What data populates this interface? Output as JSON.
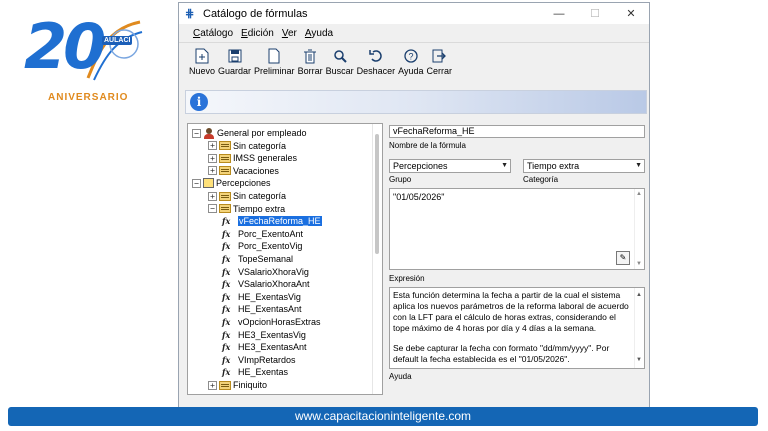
{
  "logo": {
    "number": "20",
    "badge": "AULACI",
    "anniversary": "ANIVERSARIO"
  },
  "window": {
    "title": "Catálogo de fórmulas",
    "controls": {
      "minimize": "—",
      "maximize": "☐",
      "close": "✕"
    }
  },
  "menu": [
    "Catálogo",
    "Edición",
    "Ver",
    "Ayuda"
  ],
  "toolbar": [
    {
      "label": "Nuevo",
      "icon": "new-doc-icon"
    },
    {
      "label": "Guardar",
      "icon": "save-icon"
    },
    {
      "label": "Preliminar",
      "icon": "preview-doc-icon"
    },
    {
      "label": "Borrar",
      "icon": "trash-icon"
    },
    {
      "label": "Buscar",
      "icon": "search-icon"
    },
    {
      "label": "Deshacer",
      "icon": "undo-icon"
    },
    {
      "label": "Ayuda",
      "icon": "help-icon"
    },
    {
      "label": "Cerrar",
      "icon": "exit-icon"
    }
  ],
  "info_icon": "i",
  "tree": {
    "nodes": [
      {
        "label": "General por empleado",
        "level": 0,
        "expander": "−",
        "icon": "person"
      },
      {
        "label": "Sin categoría",
        "level": 1,
        "expander": "+",
        "icon": "folder"
      },
      {
        "label": "IMSS generales",
        "level": 1,
        "expander": "+",
        "icon": "folder"
      },
      {
        "label": "Vacaciones",
        "level": 1,
        "expander": "+",
        "icon": "folder"
      },
      {
        "label": "Percepciones",
        "level": 0,
        "expander": "−",
        "icon": "plus"
      },
      {
        "label": "Sin categoría",
        "level": 1,
        "expander": "+",
        "icon": "folder"
      },
      {
        "label": "Tiempo extra",
        "level": 1,
        "expander": "−",
        "icon": "folder"
      },
      {
        "label": "vFechaReforma_HE",
        "level": 2,
        "icon": "fx",
        "selected": true
      },
      {
        "label": "Porc_ExentoAnt",
        "level": 2,
        "icon": "fx"
      },
      {
        "label": "Porc_ExentoVig",
        "level": 2,
        "icon": "fx"
      },
      {
        "label": "TopeSemanal",
        "level": 2,
        "icon": "fx"
      },
      {
        "label": "VSalarioXhoraVig",
        "level": 2,
        "icon": "fx"
      },
      {
        "label": "VSalarioXhoraAnt",
        "level": 2,
        "icon": "fx"
      },
      {
        "label": "HE_ExentasVig",
        "level": 2,
        "icon": "fx"
      },
      {
        "label": "HE_ExentasAnt",
        "level": 2,
        "icon": "fx"
      },
      {
        "label": "vOpcionHorasExtras",
        "level": 2,
        "icon": "fx"
      },
      {
        "label": "HE3_ExentasVig",
        "level": 2,
        "icon": "fx"
      },
      {
        "label": "HE3_ExentasAnt",
        "level": 2,
        "icon": "fx"
      },
      {
        "label": "VImpRetardos",
        "level": 2,
        "icon": "fx"
      },
      {
        "label": "HE_Exentas",
        "level": 2,
        "icon": "fx"
      },
      {
        "label": "Finiquito",
        "level": 1,
        "expander": "+",
        "icon": "folder"
      }
    ]
  },
  "form": {
    "name_value": "vFechaReforma_HE",
    "name_caption": "Nombre de la fórmula",
    "group_value": "Percepciones",
    "group_caption": "Grupo",
    "category_value": "Tiempo extra",
    "category_caption": "Categoría",
    "expression_value": "\"01/05/2026\"",
    "expression_caption": "Expresión",
    "help_paragraph_1": "Esta función determina la fecha a partir de la cual el sistema aplica los nuevos parámetros de la reforma laboral de acuerdo con la LFT para el cálculo de horas extras, considerando el tope máximo de 4 horas por día y 4 días a la semana.",
    "help_paragraph_2": "Se debe capturar la fecha con formato \"dd/mm/yyyy\". Por default la fecha establecida es el \"01/05/2026\".",
    "help_caption": "Ayuda"
  },
  "footer": {
    "url": "www.capacitacioninteligente.com"
  },
  "colors": {
    "accent": "#1466b5",
    "selection": "#1a6fe0",
    "logo_orange": "#e08a1e"
  }
}
